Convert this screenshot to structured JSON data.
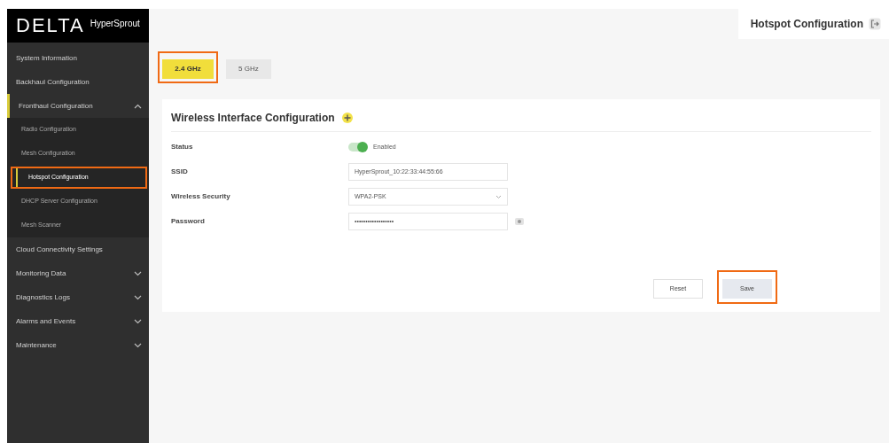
{
  "logo": {
    "brand": "DELTA",
    "product": "HyperSprout"
  },
  "sidebar": {
    "items": [
      {
        "label": "System Information",
        "selected": false
      },
      {
        "label": "Backhaul Configuration",
        "selected": false
      },
      {
        "label": "Fronthaul Configuration",
        "selected": true,
        "expanded": true,
        "children": [
          {
            "label": "Radio Configuration",
            "selected": false,
            "highlighted": false
          },
          {
            "label": "Mesh Configuration",
            "selected": false,
            "highlighted": false
          },
          {
            "label": "Hotspot Configuration",
            "selected": true,
            "highlighted": true
          },
          {
            "label": "DHCP Server Configuration",
            "selected": false,
            "highlighted": false
          },
          {
            "label": "Mesh Scanner",
            "selected": false,
            "highlighted": false
          }
        ]
      },
      {
        "label": "Cloud Connectivity Settings",
        "selected": false
      },
      {
        "label": "Monitoring Data",
        "selected": false,
        "expanded": false
      },
      {
        "label": "Diagnostics Logs",
        "selected": false,
        "expanded": false
      },
      {
        "label": "Alarms and Events",
        "selected": false,
        "expanded": false
      },
      {
        "label": "Maintenance",
        "selected": false,
        "expanded": false
      }
    ]
  },
  "header": {
    "title": "Hotspot Configuration"
  },
  "tabs": [
    {
      "label": "2.4 GHz",
      "selected": true,
      "highlighted": true
    },
    {
      "label": "5 GHz",
      "selected": false,
      "highlighted": false
    }
  ],
  "section": {
    "title": "Wireless Interface Configuration"
  },
  "fields": [
    {
      "kind": "toggle",
      "label": "Status",
      "on": true,
      "value": "Enabled"
    },
    {
      "kind": "text",
      "label": "SSID",
      "value": "HyperSprout_10:22:33:44:55:66"
    },
    {
      "kind": "select",
      "label": "Wireless Security",
      "value": "WPA2-PSK"
    },
    {
      "kind": "password",
      "label": "Password",
      "value": "••••••••••••••••••"
    }
  ],
  "buttons": [
    {
      "label": "Reset",
      "kind": "secondary",
      "highlighted": false
    },
    {
      "label": "Save",
      "kind": "primary",
      "highlighted": true
    }
  ]
}
